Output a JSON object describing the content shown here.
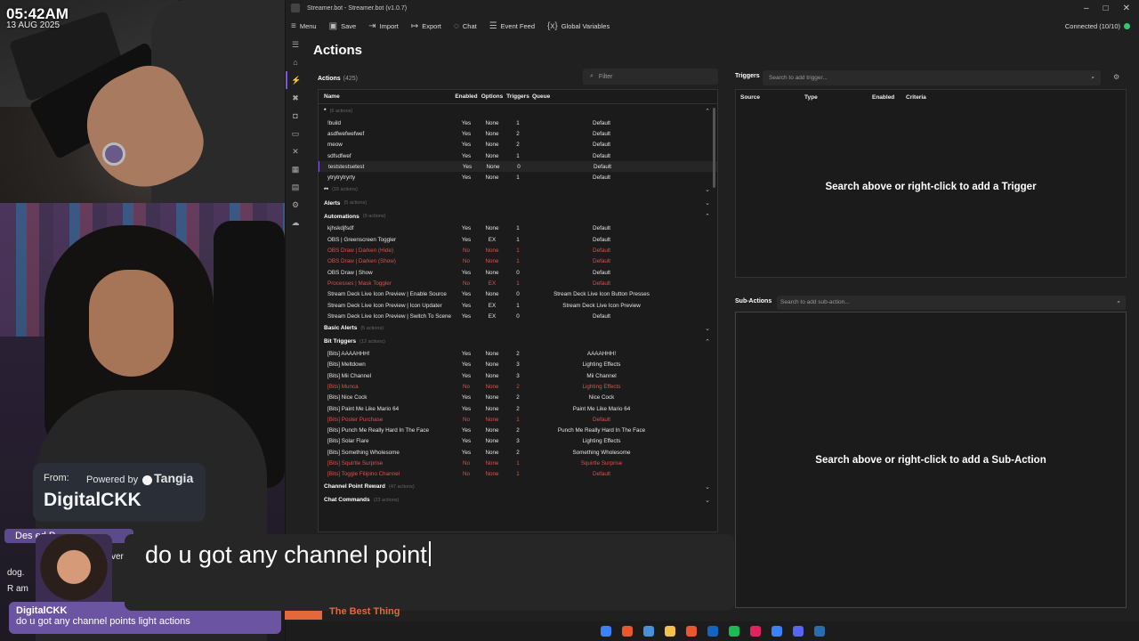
{
  "overlay": {
    "clock_time": "05:42AM",
    "clock_date": "13 AUG 2025",
    "tangia_from": "From:",
    "tangia_powered": "Powered by",
    "tangia_brand": "Tangia",
    "tangia_user": "DigitalCKK",
    "chat_bar": "Des                     ed P",
    "chat_line1": "ver",
    "chat_line2": "dog.",
    "chat_line3": "R                       am",
    "chat_final_name": "DigitalCKK",
    "chat_final_text": "do u got any channel points light actions",
    "typing_text": "do u got any channel point",
    "song_text": "The Best Thing"
  },
  "window": {
    "title": "Streamer.bot - Streamer.bot (v1.0.7)",
    "connection": "Connected (10/10)"
  },
  "menu": [
    {
      "icon": "≡",
      "label": "Menu"
    },
    {
      "icon": "▣",
      "label": "Save"
    },
    {
      "icon": "⇥",
      "label": "Import"
    },
    {
      "icon": "↦",
      "label": "Export"
    },
    {
      "icon": "◌",
      "label": "Chat"
    },
    {
      "icon": "☰",
      "label": "Event Feed"
    },
    {
      "icon": "{x}",
      "label": "Global Variables"
    }
  ],
  "page_title": "Actions",
  "actions": {
    "label": "Actions",
    "count": "(425)",
    "filter_placeholder": "Filter",
    "columns": {
      "name": "Name",
      "enabled": "Enabled",
      "options": "Options",
      "triggers": "Triggers",
      "queue": "Queue"
    }
  },
  "groups": [
    {
      "name": "*",
      "count": "(6 actions)",
      "chevron": "⌃",
      "rows": [
        {
          "name": "!build",
          "enabled": "Yes",
          "options": "None",
          "triggers": "1",
          "queue": "Default"
        },
        {
          "name": "asdfwefwefwef",
          "enabled": "Yes",
          "options": "None",
          "triggers": "2",
          "queue": "Default"
        },
        {
          "name": "meow",
          "enabled": "Yes",
          "options": "None",
          "triggers": "2",
          "queue": "Default"
        },
        {
          "name": "sdfsdfwef",
          "enabled": "Yes",
          "options": "None",
          "triggers": "1",
          "queue": "Default"
        },
        {
          "name": "teststestsetest",
          "enabled": "Yes",
          "options": "None",
          "triggers": "0",
          "queue": "Default",
          "selected": true
        },
        {
          "name": "ytrytrytryrty",
          "enabled": "Yes",
          "options": "None",
          "triggers": "1",
          "queue": "Default"
        }
      ]
    },
    {
      "name": "**",
      "count": "(15 actions)",
      "chevron": "⌄",
      "rows": []
    },
    {
      "name": "Alerts",
      "count": "(5 actions)",
      "chevron": "⌄",
      "rows": []
    },
    {
      "name": "Automations",
      "count": "(9 actions)",
      "chevron": "⌃",
      "rows": [
        {
          "name": "kjhskdjfsdf",
          "enabled": "Yes",
          "options": "None",
          "triggers": "1",
          "queue": "Default"
        },
        {
          "name": "OBS | Greenscreen Toggler",
          "enabled": "Yes",
          "options": "EX",
          "triggers": "1",
          "queue": "Default"
        },
        {
          "name": "OBS Draw | Darken (Hide)",
          "enabled": "No",
          "options": "None",
          "triggers": "1",
          "queue": "Default",
          "disabled": true
        },
        {
          "name": "OBS Draw | Darken (Show)",
          "enabled": "No",
          "options": "None",
          "triggers": "1",
          "queue": "Default",
          "disabled": true
        },
        {
          "name": "OBS Draw | Show",
          "enabled": "Yes",
          "options": "None",
          "triggers": "0",
          "queue": "Default"
        },
        {
          "name": "Processes | Mask Toggler",
          "enabled": "No",
          "options": "EX",
          "triggers": "1",
          "queue": "Default",
          "disabled": true
        },
        {
          "name": "Stream Deck Live Icon Preview | Enable Source",
          "enabled": "Yes",
          "options": "None",
          "triggers": "0",
          "queue": "Stream Deck Live Icon Button Presses"
        },
        {
          "name": "Stream Deck Live Icon Preview | Icon Updater",
          "enabled": "Yes",
          "options": "EX",
          "triggers": "1",
          "queue": "Stream Deck Live Icon Preview"
        },
        {
          "name": "Stream Deck Live Icon Preview | Switch To Scene",
          "enabled": "Yes",
          "options": "EX",
          "triggers": "0",
          "queue": "Default"
        }
      ]
    },
    {
      "name": "Basic Alerts",
      "count": "(5 actions)",
      "chevron": "⌄",
      "rows": []
    },
    {
      "name": "Bit Triggers",
      "count": "(12 actions)",
      "chevron": "⌃",
      "rows": [
        {
          "name": "[Bits] AAAAHHH!",
          "enabled": "Yes",
          "options": "None",
          "triggers": "2",
          "queue": "AAAAHHH!"
        },
        {
          "name": "[Bits] Meltdown",
          "enabled": "Yes",
          "options": "None",
          "triggers": "3",
          "queue": "Lighting Effects"
        },
        {
          "name": "[Bits] Mii Channel",
          "enabled": "Yes",
          "options": "None",
          "triggers": "3",
          "queue": "Mii Channel"
        },
        {
          "name": "[Bits] Munca",
          "enabled": "No",
          "options": "None",
          "triggers": "2",
          "queue": "Lighting Effects",
          "disabled": true
        },
        {
          "name": "[Bits] Nice Cock",
          "enabled": "Yes",
          "options": "None",
          "triggers": "2",
          "queue": "Nice Cock"
        },
        {
          "name": "[Bits] Paint Me Like Mario 64",
          "enabled": "Yes",
          "options": "None",
          "triggers": "2",
          "queue": "Paint Me Like Mario 64"
        },
        {
          "name": "[Bits] Poster Purchase",
          "enabled": "No",
          "options": "None",
          "triggers": "1",
          "queue": "Default",
          "disabled": true
        },
        {
          "name": "[Bits] Punch Me Really Hard In The Face",
          "enabled": "Yes",
          "options": "None",
          "triggers": "2",
          "queue": "Punch Me Really Hard In The Face"
        },
        {
          "name": "[Bits] Solar Flare",
          "enabled": "Yes",
          "options": "None",
          "triggers": "3",
          "queue": "Lighting Effects"
        },
        {
          "name": "[Bits] Something Wholesome",
          "enabled": "Yes",
          "options": "None",
          "triggers": "2",
          "queue": "Something Wholesome"
        },
        {
          "name": "[Bits] Squirtle Surprise",
          "enabled": "No",
          "options": "None",
          "triggers": "1",
          "queue": "Squirtle Surprise",
          "disabled": true
        },
        {
          "name": "[Bits] Toggle Filipino Channel",
          "enabled": "No",
          "options": "None",
          "triggers": "1",
          "queue": "Default",
          "disabled": true
        }
      ]
    },
    {
      "name": "Channel Point Reward",
      "count": "(47 actions)",
      "chevron": "⌄",
      "rows": []
    },
    {
      "name": "Chat Commands",
      "count": "(23 actions)",
      "chevron": "⌄",
      "rows": []
    }
  ],
  "triggers": {
    "label": "Triggers",
    "search_placeholder": "Search to add trigger...",
    "columns": [
      "Source",
      "Type",
      "Enabled",
      "Criteria"
    ],
    "empty": "Search above or right-click to add a Trigger"
  },
  "subactions": {
    "label": "Sub-Actions",
    "search_placeholder": "Search to add sub-action...",
    "empty": "Search above or right-click to add a Sub-Action"
  },
  "taskbar_colors": [
    "#3b82f6",
    "#e8572f",
    "#4a90d9",
    "#f2c14e",
    "#e8572f",
    "#1565c0",
    "#1db954",
    "#e0245e",
    "#3b82f6",
    "#5865f2",
    "#2b6cb0"
  ]
}
